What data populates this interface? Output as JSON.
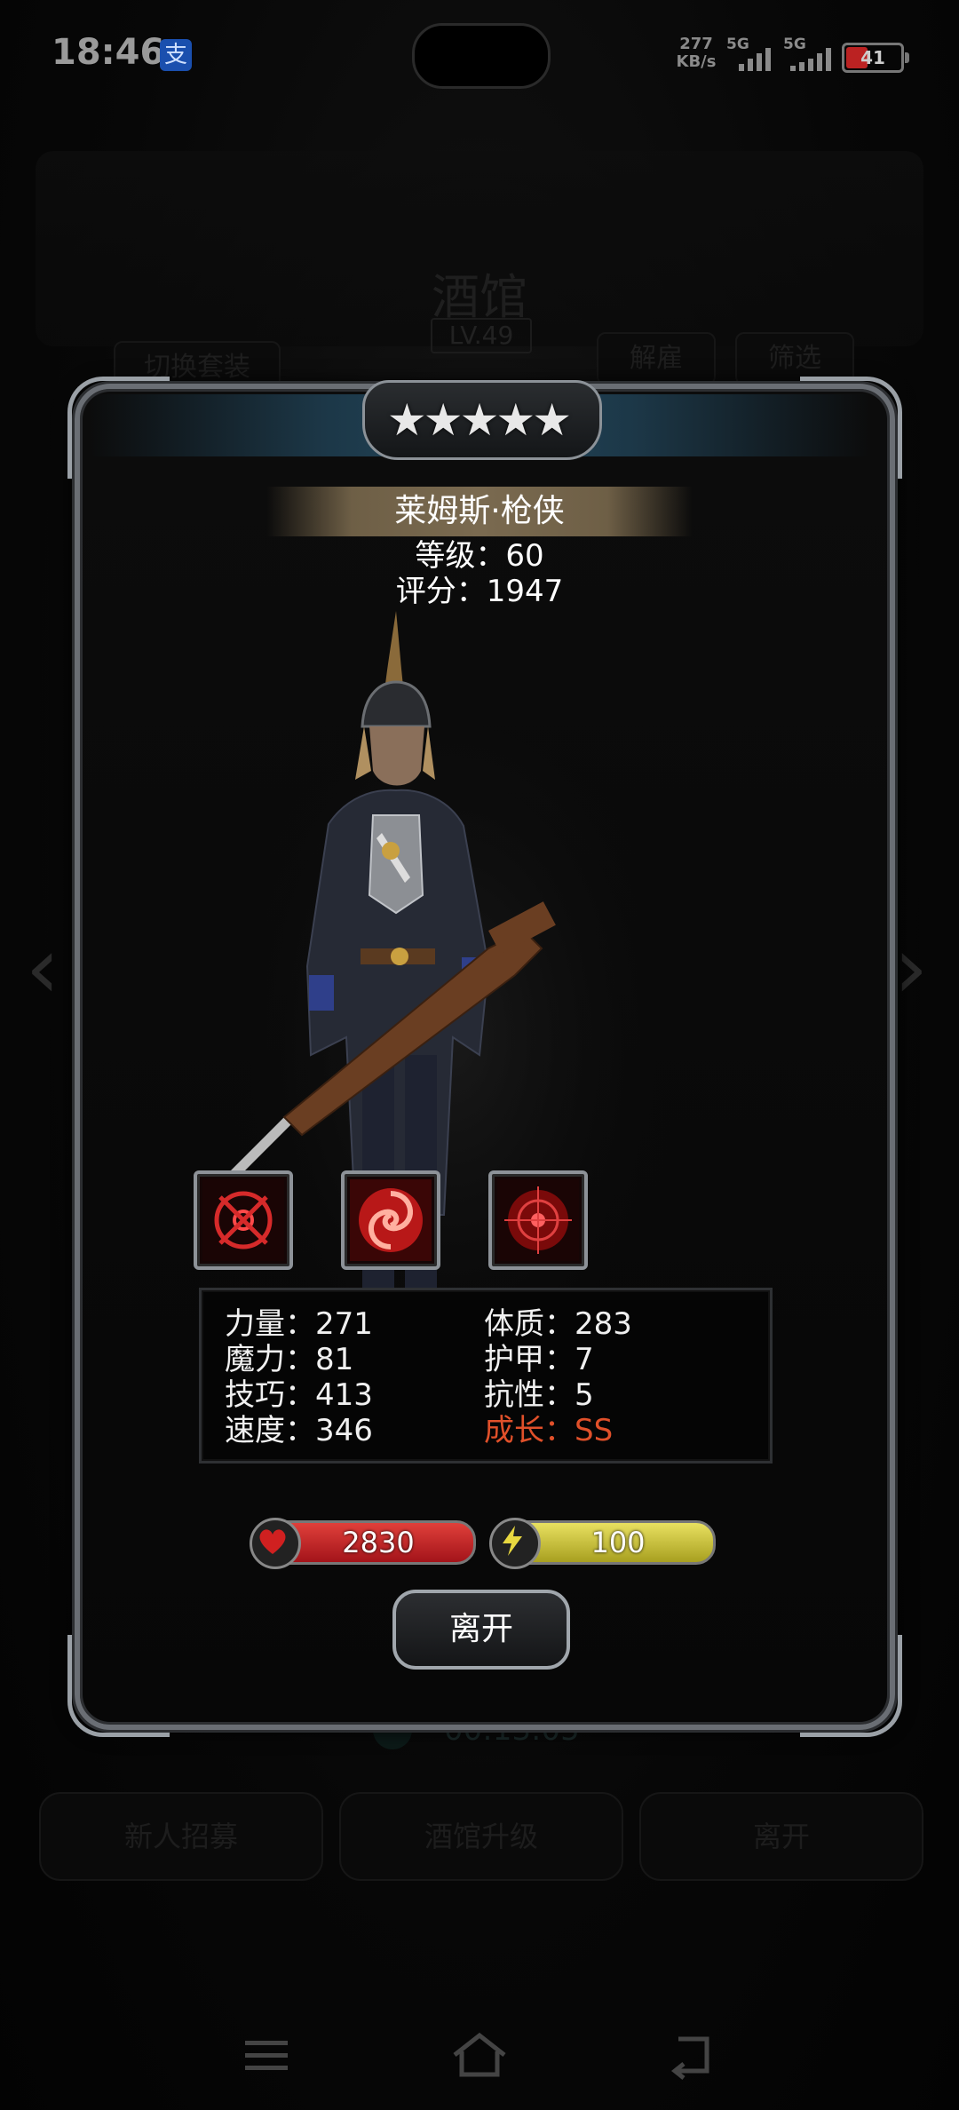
{
  "status_bar": {
    "time": "18:46",
    "alipay_glyph": "支",
    "net_speed_value": "277",
    "net_speed_unit": "KB/s",
    "signal1_tag": "5G",
    "signal2_tag": "5G",
    "battery": "41"
  },
  "background": {
    "title": "酒馆",
    "level": "LV.49",
    "switch_outfit": "切换套装",
    "dismiss": "解雇",
    "filter": "筛选",
    "timer": "00:13:05",
    "recruit": "新人招募",
    "upgrade_tavern": "酒馆升级",
    "leave": "离开"
  },
  "hero": {
    "stars": 5,
    "name": "莱姆斯·枪侠",
    "level": "等级：60",
    "rating": "评分：1947",
    "skills": [
      "crosshair-skill-icon",
      "swirl-skill-icon",
      "target-skill-icon"
    ]
  },
  "stats": {
    "strength": "力量：271",
    "magic": "魔力：81",
    "skill": "技巧：413",
    "speed": "速度：346",
    "constitution": "体质：283",
    "armor": "护甲：7",
    "resistance": "抗性：5",
    "growth": "成长：SS"
  },
  "bars": {
    "hp": "2830",
    "energy": "100"
  },
  "modal": {
    "leave_button": "离开"
  },
  "colors": {
    "growth": "#e0502a",
    "hp": "#c72026",
    "energy": "#d6cf3c"
  }
}
